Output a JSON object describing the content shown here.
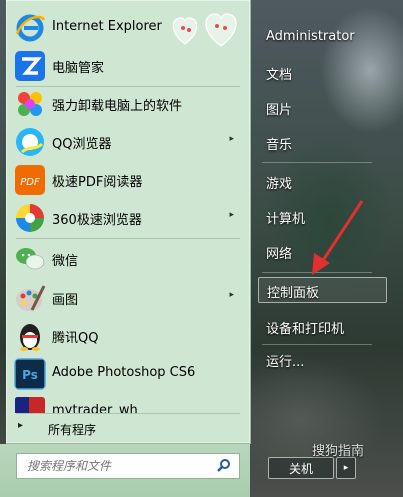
{
  "pinned_programs": [
    {
      "label": "Internet Explorer",
      "icon": "internet-explorer-icon"
    },
    {
      "label": "电脑管家",
      "icon": "pc-manager-icon"
    }
  ],
  "recent_programs": [
    {
      "label": "强力卸载电脑上的软件",
      "icon": "uninstaller-icon",
      "submenu": false
    },
    {
      "label": "QQ浏览器",
      "icon": "qq-browser-icon",
      "submenu": true
    },
    {
      "label": "极速PDF阅读器",
      "icon": "pdf-reader-icon",
      "submenu": false
    },
    {
      "label": "360极速浏览器",
      "icon": "360-browser-icon",
      "submenu": true
    },
    {
      "label": "微信",
      "icon": "wechat-icon",
      "submenu": false
    },
    {
      "label": "画图",
      "icon": "paint-icon",
      "submenu": true
    },
    {
      "label": "腾讯QQ",
      "icon": "qq-icon",
      "submenu": false
    },
    {
      "label": "Adobe Photoshop CS6",
      "icon": "photoshop-icon",
      "submenu": false
    },
    {
      "label": "mytrader_wh",
      "icon": "mytrader-icon",
      "submenu": false
    }
  ],
  "all_programs": "所有程序",
  "search_placeholder": "搜索程序和文件",
  "right_items": {
    "user": "Administrator",
    "documents": "文档",
    "pictures": "图片",
    "music": "音乐",
    "games": "游戏",
    "computer": "计算机",
    "network": "网络",
    "control_panel": "控制面板",
    "devices": "设备和打印机",
    "run": "运行..."
  },
  "shutdown_label": "关机",
  "watermark": "搜狗指南",
  "colors": {
    "pane": "#cfe7d2",
    "accent_arrow": "#e03030"
  }
}
